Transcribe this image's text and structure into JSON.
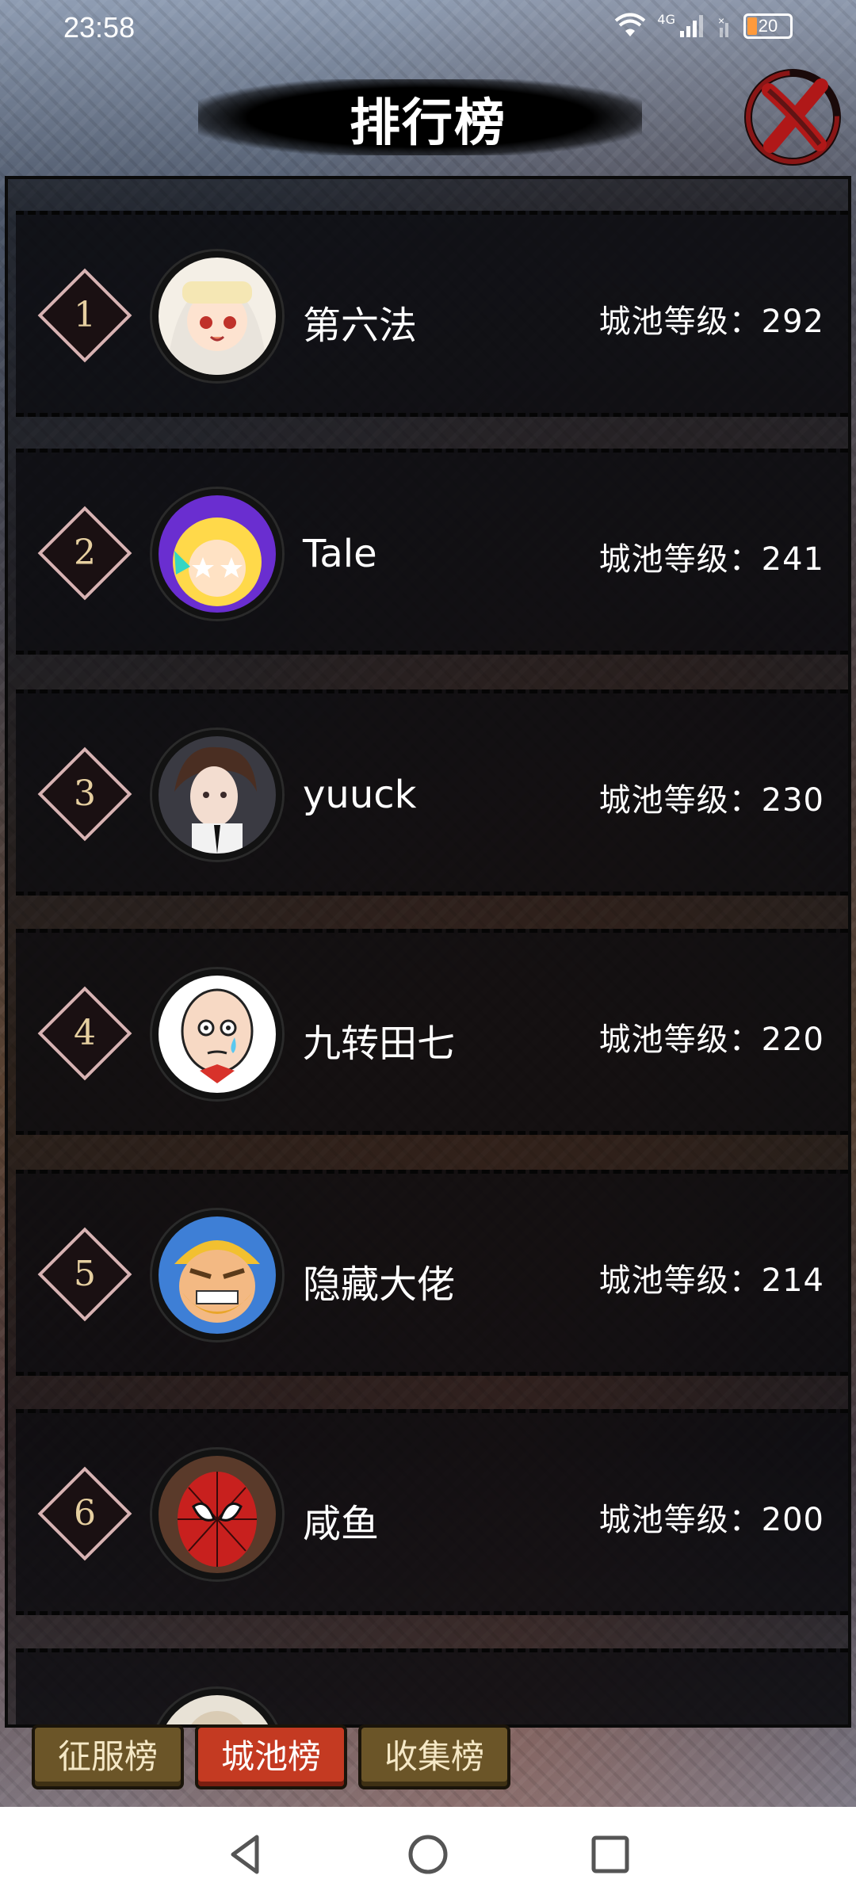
{
  "status_bar": {
    "time": "23:58",
    "network": "4G",
    "battery": "20",
    "icons": [
      "wifi-icon",
      "signal-icon",
      "battery-icon"
    ]
  },
  "header": {
    "title": "排行榜",
    "close_icon": "close-icon"
  },
  "leaderboard": {
    "level_prefix": "城池等级：",
    "rows": [
      {
        "rank": "1",
        "name": "第六法",
        "level": "城池等级：292",
        "avatar": "anime-girl-avatar"
      },
      {
        "rank": "2",
        "name": "Tale",
        "level": "城池等级：241",
        "avatar": "star-eyes-avatar"
      },
      {
        "rank": "3",
        "name": "yuuck",
        "level": "城池等级：230",
        "avatar": "anime-boy-avatar"
      },
      {
        "rank": "4",
        "name": "九转田七",
        "level": "城池等级：220",
        "avatar": "bald-cartoon-avatar"
      },
      {
        "rank": "5",
        "name": "隐藏大佬",
        "level": "城池等级：214",
        "avatar": "barbarian-avatar"
      },
      {
        "rank": "6",
        "name": "咸鱼",
        "level": "城池等级：200",
        "avatar": "spider-mask-avatar"
      }
    ]
  },
  "tabs": [
    {
      "label": "征服榜",
      "active": false
    },
    {
      "label": "城池榜",
      "active": true
    },
    {
      "label": "收集榜",
      "active": false
    }
  ],
  "colors": {
    "active_tab": "#c43a22",
    "inactive_tab": "#6b5528",
    "rank_border": "#d8b3b3"
  }
}
